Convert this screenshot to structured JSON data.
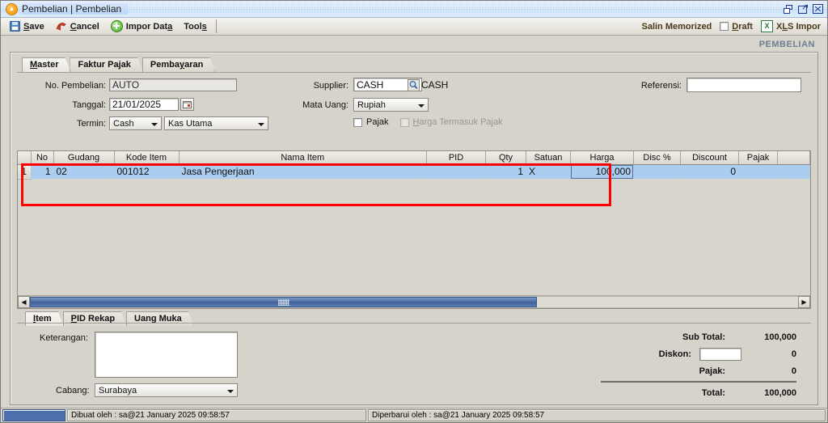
{
  "window": {
    "title": "Pembelian | Pembelian",
    "app_icon": "chevron-circle-icon",
    "controls": [
      {
        "name": "restore-button",
        "glyph": "restore"
      },
      {
        "name": "maximize-button",
        "glyph": "maximize"
      },
      {
        "name": "close-button",
        "glyph": "close"
      }
    ]
  },
  "toolbar": {
    "save_label": "Save",
    "cancel_label": "Cancel",
    "impor_label": "Impor Data",
    "tools_label": "Tools",
    "salin_memorized_label": "Salin Memorized",
    "draft_label": "Draft",
    "xls_impor_label": "XLS Impor",
    "xls_icon_text": "X"
  },
  "module_title": "PEMBELIAN",
  "tabs": [
    {
      "label": "Master",
      "active": true
    },
    {
      "label": "Faktur Pajak",
      "active": false
    },
    {
      "label": "Pembayaran",
      "active": false
    }
  ],
  "form": {
    "no_pembelian_label": "No. Pembelian:",
    "no_pembelian_value": "AUTO",
    "tanggal_label": "Tanggal:",
    "tanggal_value": "21/01/2025",
    "termin_label": "Termin:",
    "termin_value": "Cash",
    "termin_akun_value": "Kas Utama",
    "supplier_label": "Supplier:",
    "supplier_value": "CASH",
    "supplier_name": "CASH",
    "mata_uang_label": "Mata Uang:",
    "mata_uang_value": "Rupiah",
    "pajak_label": "Pajak",
    "harga_termasuk_pajak_label": "Harga Termasuk Pajak",
    "referensi_label": "Referensi:",
    "referensi_value": ""
  },
  "grid": {
    "columns": [
      "No",
      "Gudang",
      "Kode Item",
      "Nama Item",
      "PID",
      "Qty",
      "Satuan",
      "Harga",
      "Disc %",
      "Discount",
      "Pajak",
      ""
    ],
    "rows": [
      {
        "row_header": "1",
        "no": "1",
        "gudang": "02",
        "kode_item": "001012",
        "nama_item": "Jasa Pengerjaan",
        "pid": "",
        "qty": "1",
        "satuan": "X",
        "harga": "100,000",
        "disc_persen": "",
        "discount": "0",
        "pajak": "",
        "extra": ""
      }
    ]
  },
  "lower_tabs": [
    {
      "label": "Item",
      "active": true
    },
    {
      "label": "PID Rekap",
      "active": false
    },
    {
      "label": "Uang Muka",
      "active": false
    }
  ],
  "footer": {
    "keterangan_label": "Keterangan:",
    "keterangan_value": "",
    "cabang_label": "Cabang:",
    "cabang_value": "Surabaya",
    "sub_total_label": "Sub Total:",
    "sub_total_value": "100,000",
    "diskon_label": "Diskon:",
    "diskon_input_value": "",
    "diskon_value": "0",
    "pajak_label": "Pajak:",
    "pajak_value": "0",
    "total_label": "Total:",
    "total_value": "100,000"
  },
  "statusbar": {
    "created": "Dibuat oleh : sa@21 January 2025  09:58:57",
    "updated": "Diperbarui oleh : sa@21 January 2025  09:58:57"
  },
  "colors": {
    "title_blue": "#bfd9f7",
    "row_highlight": "#aacdf0",
    "annotation_red": "#ff0000",
    "module_title": "#6f7d92",
    "scrollbar_thumb": "#41619c"
  }
}
